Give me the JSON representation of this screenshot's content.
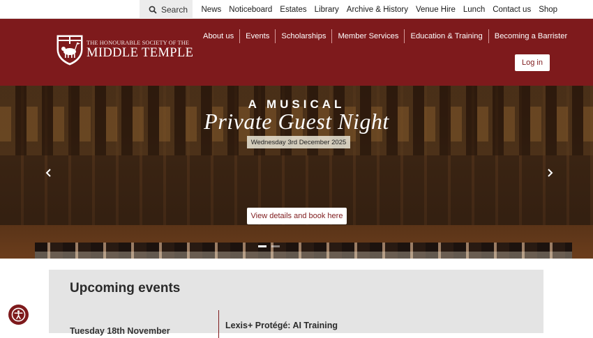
{
  "topbar": {
    "search_label": "Search",
    "links": [
      "News",
      "Noticeboard",
      "Estates",
      "Library",
      "Archive & History",
      "Venue Hire",
      "Lunch",
      "Contact us",
      "Shop"
    ]
  },
  "header": {
    "logo_line1": "THE HONOURABLE SOCIETY OF THE",
    "logo_line2": "MIDDLE TEMPLE",
    "nav": [
      "About us",
      "Events",
      "Scholarships",
      "Member Services",
      "Education & Training",
      "Becoming a Barrister"
    ],
    "login_label": "Log in",
    "brand_color": "#7e1a1c"
  },
  "hero": {
    "title_line1": "A MUSICAL",
    "title_line2": "Private Guest Night",
    "date": "Wednesday 3rd December 2025",
    "cta_label": "View details and book here",
    "prev_icon": "chevron-left-icon",
    "next_icon": "chevron-right-icon",
    "slide_count": 2,
    "active_slide": 1
  },
  "events": {
    "heading": "Upcoming events",
    "items": [
      {
        "date": "Tuesday 18th November",
        "title": "Lexis+ Protégé: AI Training"
      }
    ]
  },
  "accessibility": {
    "icon": "accessibility-icon"
  }
}
